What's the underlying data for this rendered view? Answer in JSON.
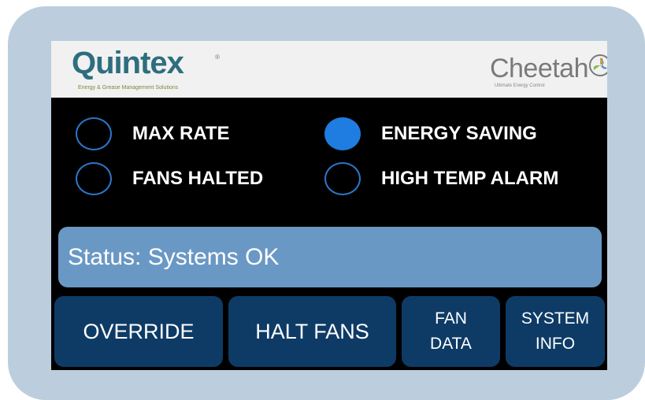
{
  "header": {
    "left_logo": {
      "name": "Quintex",
      "tagline": "Energy & Grease Management Solutions",
      "mark": "®"
    },
    "right_logo": {
      "name": "Cheetah",
      "tagline": "Ultimate Energy Control"
    }
  },
  "indicators": [
    {
      "label": "MAX RATE",
      "active": false
    },
    {
      "label": "ENERGY SAVING",
      "active": true
    },
    {
      "label": "FANS HALTED",
      "active": false
    },
    {
      "label": "HIGH TEMP ALARM",
      "active": false
    }
  ],
  "status": {
    "text": "Status: Systems OK"
  },
  "buttons": {
    "override": "OVERRIDE",
    "halt_fans": "HALT FANS",
    "fan_data": {
      "line1": "FAN",
      "line2": "DATA"
    },
    "system_info": {
      "line1": "SYSTEM",
      "line2": "INFO"
    }
  },
  "colors": {
    "led_on": "#1f7ce0",
    "led_ring": "#2a77c9",
    "status_bar": "#6a98c4",
    "button": "#0e3b66",
    "bezel": "#bccedd"
  }
}
